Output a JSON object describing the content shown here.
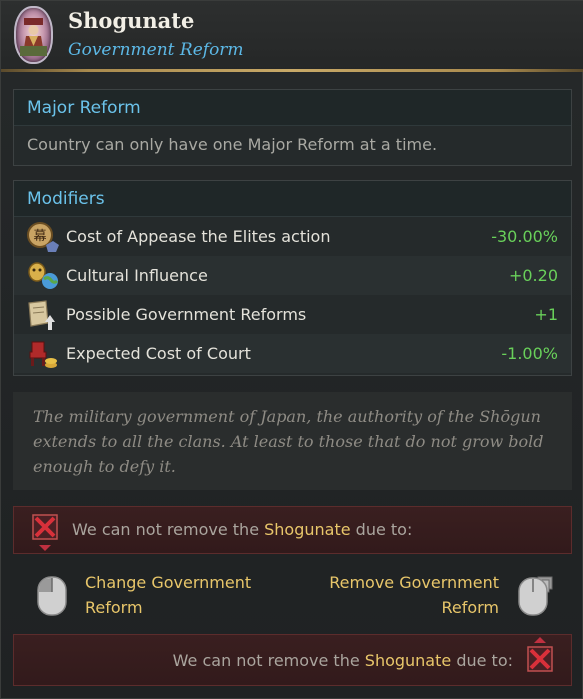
{
  "header": {
    "title": "Shogunate",
    "subtitle": "Government Reform",
    "emblem_icon": "shogunate-emblem-icon"
  },
  "major_reform": {
    "heading": "Major Reform",
    "text": "Country can only have one Major Reform at a time."
  },
  "modifiers": {
    "heading": "Modifiers",
    "items": [
      {
        "icon": "appease-elites-icon",
        "label": "Cost of Appease the Elites action",
        "value": "-30.00%"
      },
      {
        "icon": "cultural-influence-icon",
        "label": "Cultural Influence",
        "value": "+0.20"
      },
      {
        "icon": "government-reforms-icon",
        "label": "Possible Government Reforms",
        "value": "+1"
      },
      {
        "icon": "court-cost-icon",
        "label": "Expected Cost of Court",
        "value": "-1.00%"
      }
    ]
  },
  "flavor_text": "The military government of Japan, the authority of the Shōgun extends to all the clans. At least to those that do not grow bold enough to defy it.",
  "warning_top": {
    "prefix": "We can not remove the ",
    "highlight": "Shogunate",
    "suffix": " due to:"
  },
  "actions": {
    "left_label_line1": "Change Government",
    "left_label_line2": "Reform",
    "right_label_line1": "Remove Government",
    "right_label_line2": "Reform"
  },
  "warning_bottom": {
    "prefix": "We can not remove the ",
    "highlight": "Shogunate",
    "suffix": " due to:"
  },
  "colors": {
    "accent_blue": "#6bc3eb",
    "positive_green": "#69d05a",
    "highlight_gold": "#e8c66a",
    "warning_red": "#c0303a"
  }
}
